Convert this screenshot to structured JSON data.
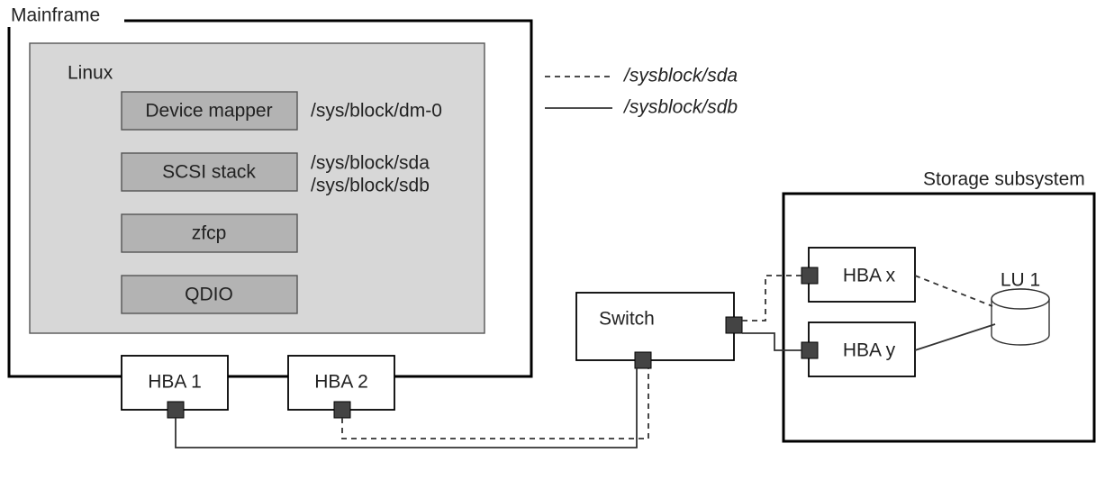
{
  "title": "Mainframe",
  "linux": {
    "title": "Linux",
    "layers": [
      {
        "name": "Device mapper",
        "paths": [
          "/sys/block/dm-0"
        ]
      },
      {
        "name": "SCSI stack",
        "paths": [
          "/sys/block/sda",
          "/sys/block/sdb"
        ]
      },
      {
        "name": "zfcp",
        "paths": []
      },
      {
        "name": "QDIO",
        "paths": []
      }
    ]
  },
  "mainframe_hbas": [
    "HBA 1",
    "HBA 2"
  ],
  "switch_label": "Switch",
  "storage": {
    "title": "Storage subsystem",
    "hbas": [
      "HBA x",
      "HBA y"
    ],
    "lu": "LU 1"
  },
  "legend": [
    {
      "style": "dashed",
      "label": "/sysblock/sda"
    },
    {
      "style": "solid",
      "label": "/sysblock/sdb"
    }
  ]
}
